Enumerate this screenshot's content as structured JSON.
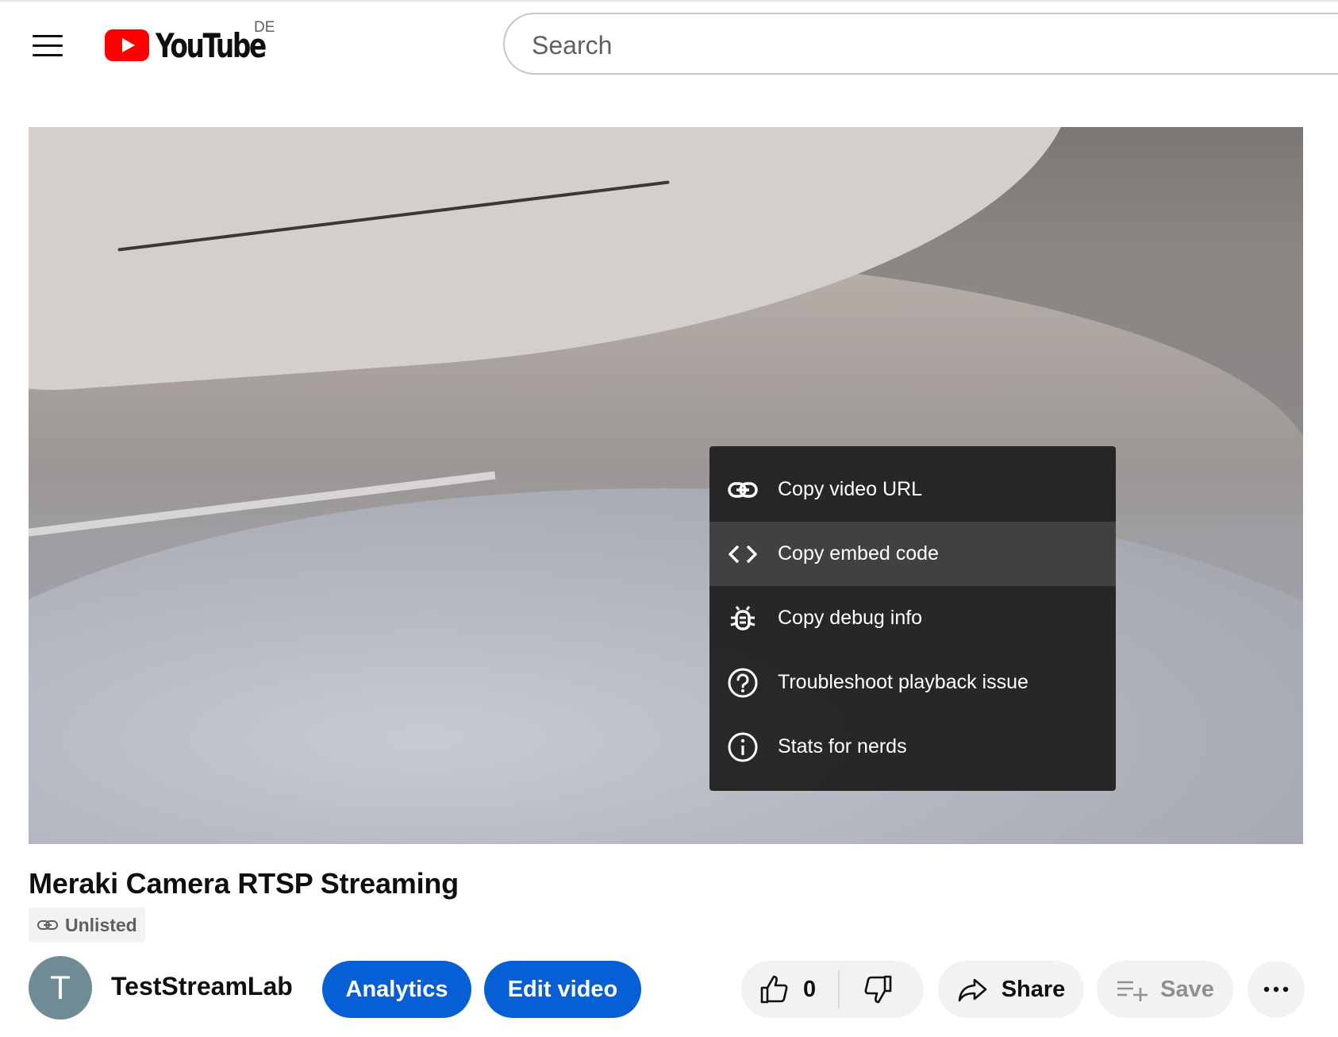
{
  "header": {
    "logo_text": "YouTube",
    "country_code": "DE",
    "search_placeholder": "Search"
  },
  "colors": {
    "brand_red": "#ff0000",
    "action_blue": "#065fd4",
    "menu_bg": "#212121"
  },
  "context_menu": {
    "items": [
      {
        "label": "Copy video URL",
        "icon": "link-icon"
      },
      {
        "label": "Copy embed code",
        "icon": "code-icon",
        "highlighted": true
      },
      {
        "label": "Copy debug info",
        "icon": "bug-icon"
      },
      {
        "label": "Troubleshoot playback issue",
        "icon": "help-circle-icon"
      },
      {
        "label": "Stats for nerds",
        "icon": "info-circle-icon"
      }
    ]
  },
  "video": {
    "title": "Meraki Camera RTSP Streaming",
    "visibility": "Unlisted"
  },
  "channel": {
    "avatar_letter": "T",
    "name": "TestStreamLab"
  },
  "actions": {
    "analytics_label": "Analytics",
    "edit_label": "Edit video",
    "like_count": "0",
    "share_label": "Share",
    "save_label": "Save"
  }
}
